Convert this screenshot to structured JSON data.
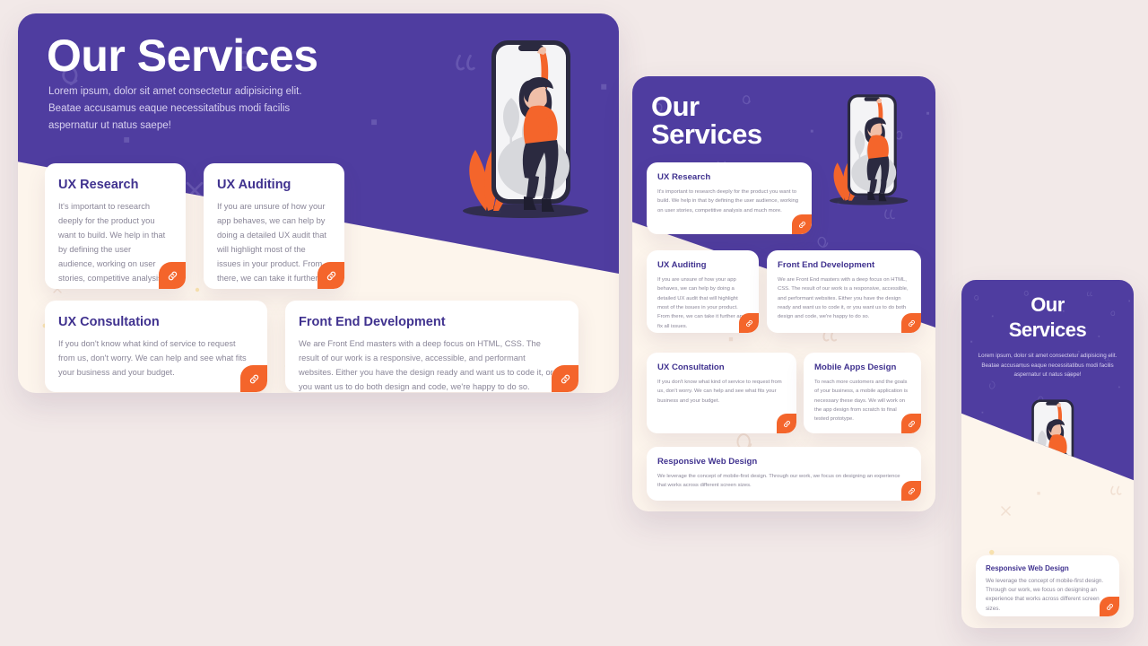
{
  "page": {
    "background_color": "#F2E9E8",
    "purple": "#4F3DA0",
    "cream": "#FDF5EC",
    "orange": "#F4652B",
    "heading_color": "#40328F",
    "body_color": "#8A8698"
  },
  "hero": {
    "title": "Our Services",
    "title_line1": "Our",
    "title_line2": "Services",
    "subtitle": "Lorem ipsum, dolor sit amet consectetur adipisicing elit. Beatae accusamus eaque necessitatibus modi facilis aspernatur ut natus saepe!",
    "illustration_name": "woman-with-phone-illustration",
    "link_icon": "link-icon"
  },
  "services": [
    {
      "title": "UX Research",
      "body": "It's important to research deeply for the product you want to build. We help in that by defining the user audience, working on user stories, competitive analysis and much more."
    },
    {
      "title": "UX Auditing",
      "body": "If you are unsure of how your app behaves, we can help by doing a detailed UX audit that will highlight most of the issues in your product. From there, we can take it further and fix all issues."
    },
    {
      "title": "UX Consultation",
      "body": "If you don't know what kind of service to request from us, don't worry. We can help and see what fits your business and your budget."
    },
    {
      "title": "Front End Development",
      "body": "We are Front End masters with a deep focus on HTML, CSS. The result of our work is a responsive, accessible, and performant websites. Either you have the design ready and want us to code it, or you want us to do both design and code, we're happy to do so."
    },
    {
      "title": "Mobile Apps Design",
      "body": "To reach more customers and the goals of your business, a mobile application is necessary these days. We will work on the app design from scratch to final tested prototype."
    },
    {
      "title": "Responsive Web Design",
      "body": "We leverage the concept of mobile-first design. Through our work, we focus on designing an experience that works across different screen sizes."
    }
  ],
  "panels": {
    "desktop": {
      "name": "desktop-preview"
    },
    "tablet": {
      "name": "tablet-preview"
    },
    "mobile": {
      "name": "mobile-preview"
    }
  }
}
